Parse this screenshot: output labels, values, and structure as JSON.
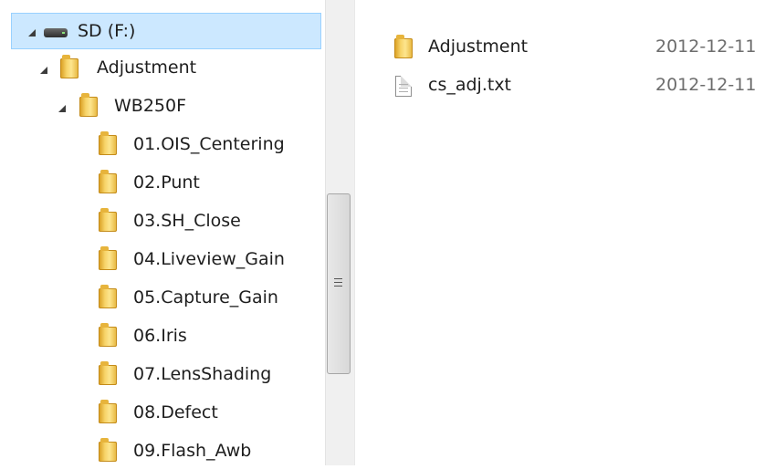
{
  "tree": {
    "drive_label": "SD (F:)",
    "folders": [
      {
        "label": "Adjustment"
      },
      {
        "label": "WB250F"
      },
      {
        "label": "01.OIS_Centering"
      },
      {
        "label": "02.Punt"
      },
      {
        "label": "03.SH_Close"
      },
      {
        "label": "04.Liveview_Gain"
      },
      {
        "label": "05.Capture_Gain"
      },
      {
        "label": "06.Iris"
      },
      {
        "label": "07.LensShading"
      },
      {
        "label": "08.Defect"
      },
      {
        "label": "09.Flash_Awb"
      }
    ]
  },
  "files": [
    {
      "name": "Adjustment",
      "date": "2012-12-11",
      "icon": "folder-icon"
    },
    {
      "name": "cs_adj.txt",
      "date": "2012-12-11",
      "icon": "text-file-icon"
    }
  ],
  "colors": {
    "selection": "#cce8ff",
    "selection_border": "#99d1ff",
    "folder": "#f7d469",
    "date_text": "#6d6d6d"
  }
}
